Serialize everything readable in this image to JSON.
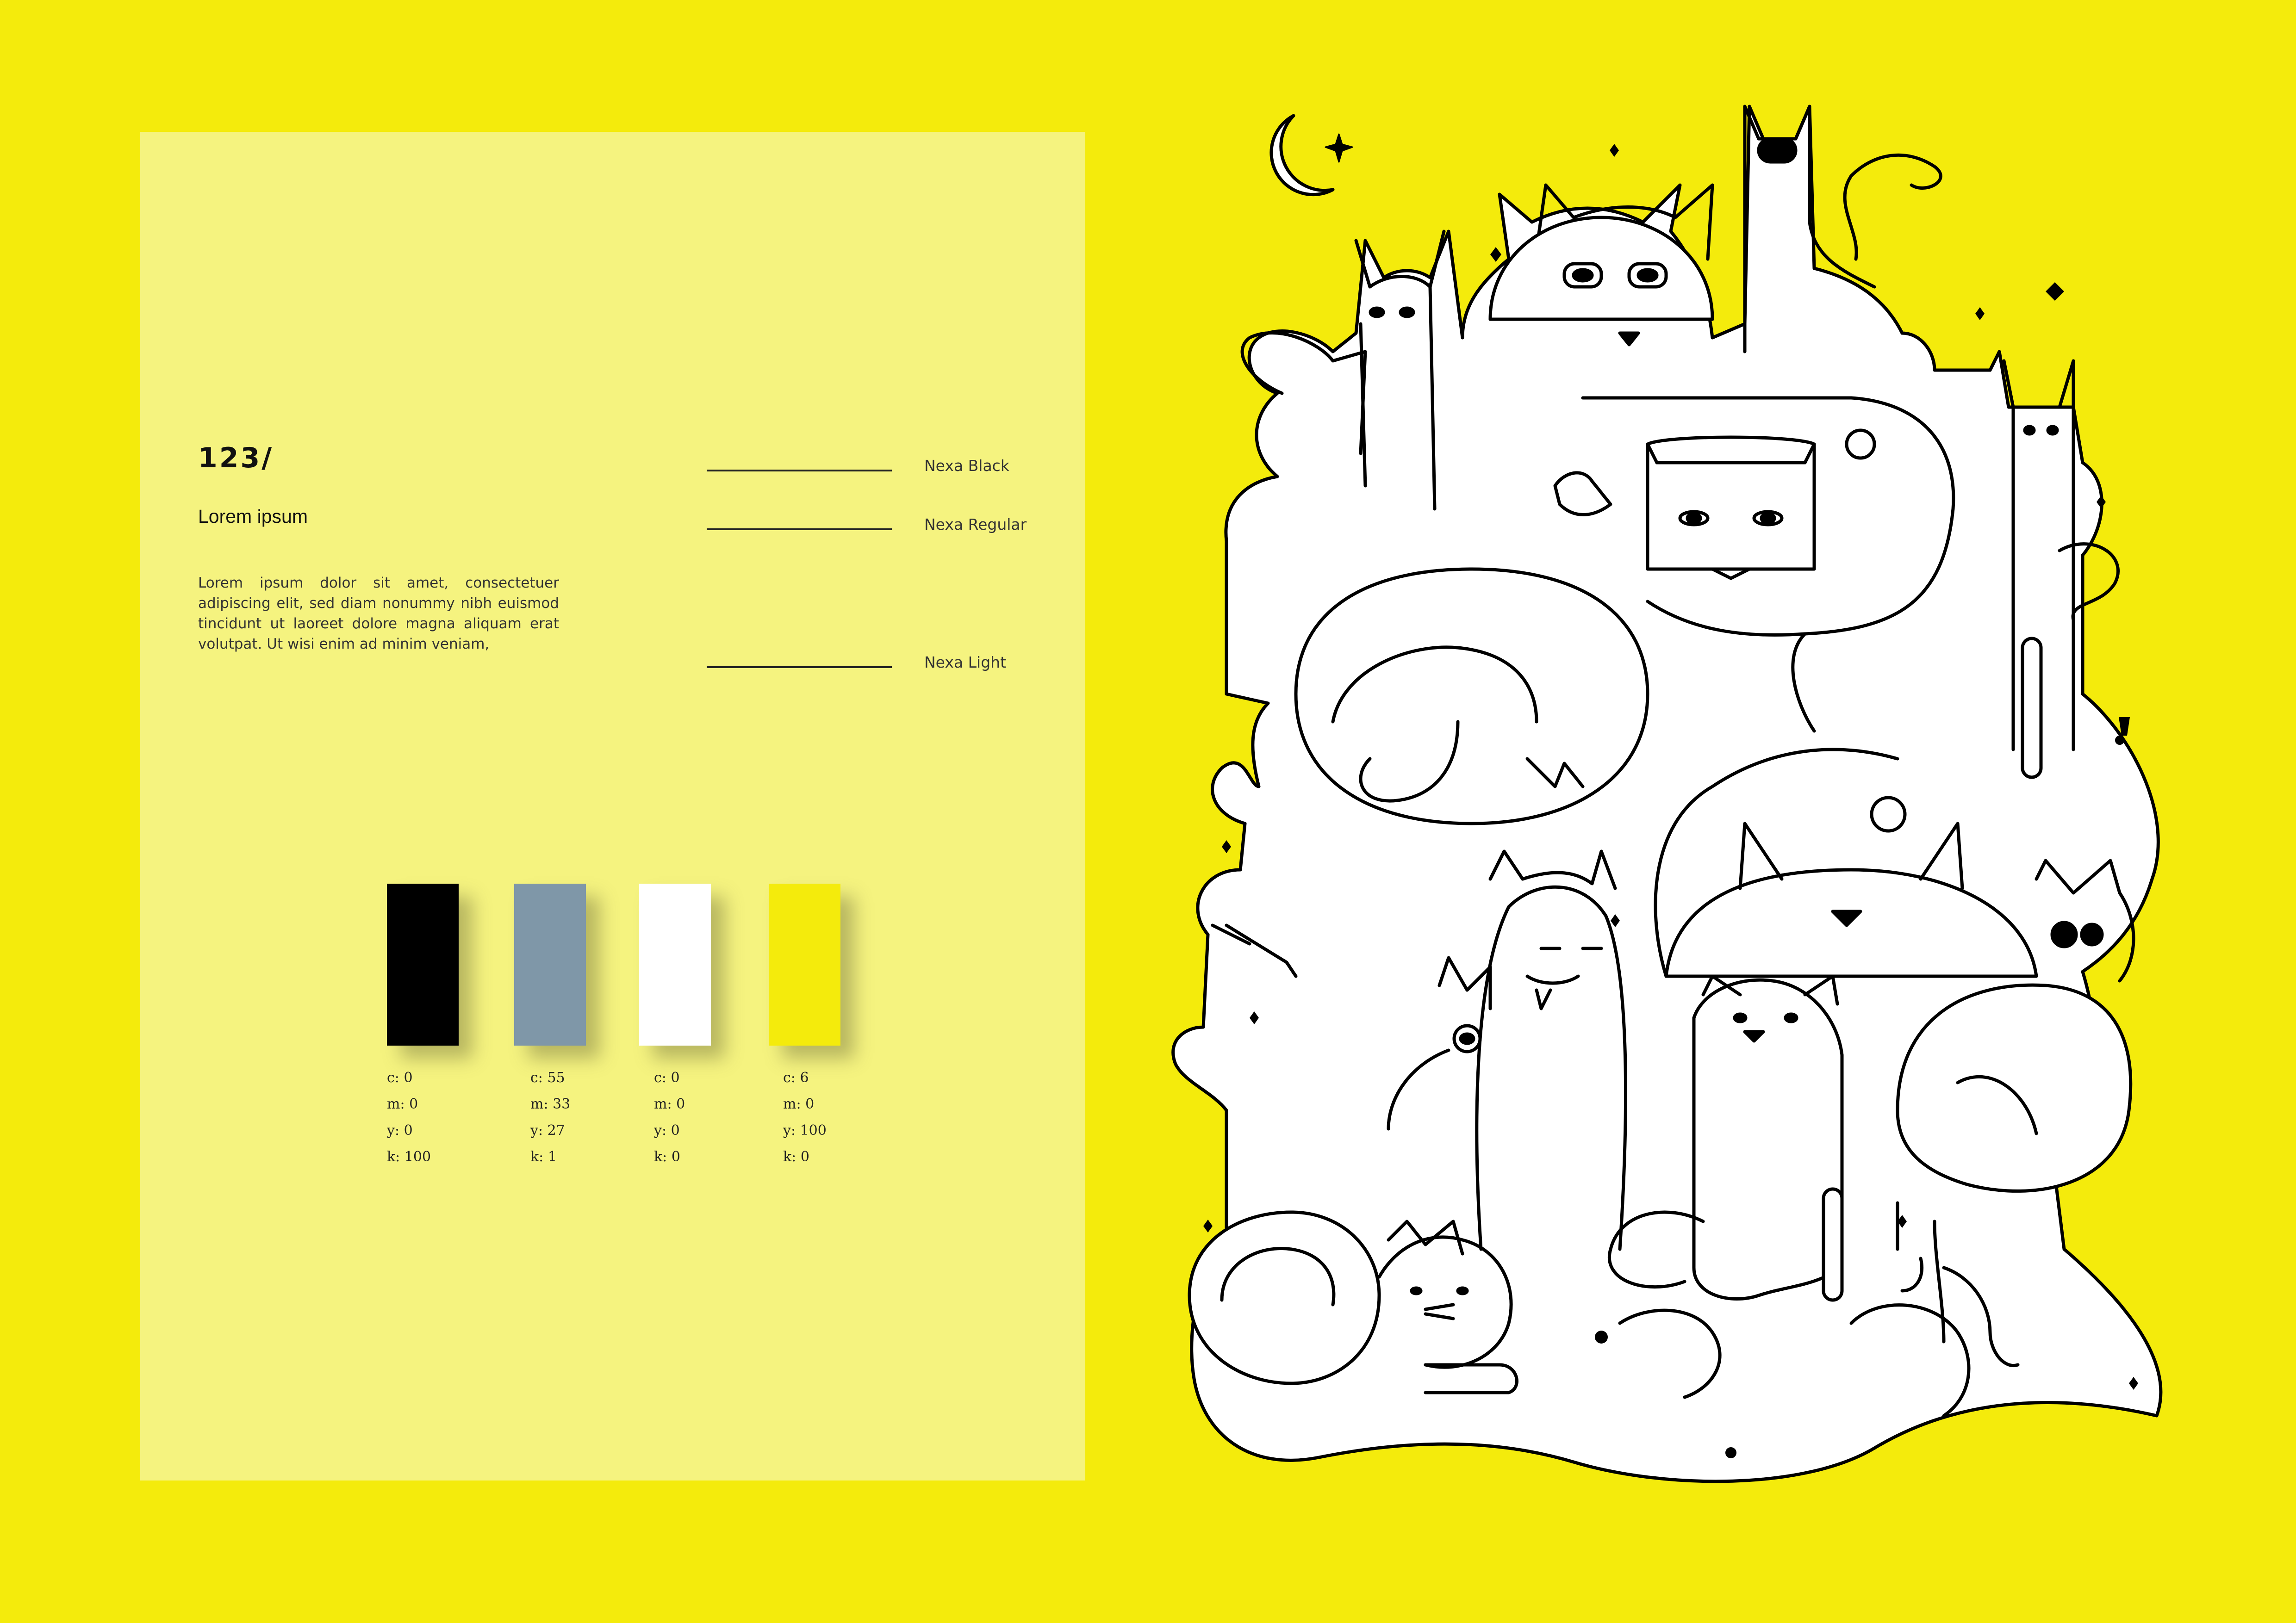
{
  "panel": {
    "number": "123/",
    "subtitle": "Lorem ipsum",
    "body": "Lorem ipsum dolor sit amet, consectetuer adipiscing elit, sed diam nonummy nibh euismod tincidunt ut laoreet dolore magna aliquam erat volutpat. Ut wisi enim ad minim veniam,"
  },
  "fonts": [
    {
      "label": "Nexa Black"
    },
    {
      "label": "Nexa Regular"
    },
    {
      "label": "Nexa Light"
    }
  ],
  "swatches": [
    {
      "color": "#000000",
      "c": "c: 0",
      "m": "m: 0",
      "y": "y: 0",
      "k": "k: 100"
    },
    {
      "color": "#7f97a8",
      "c": "c: 55",
      "m": "m: 33",
      "y": "y: 27",
      "k": "k: 1"
    },
    {
      "color": "#ffffff",
      "c": "c: 0",
      "m": "m: 0",
      "y": "y: 0",
      "k": "k: 0"
    },
    {
      "color": "#f4eb0c",
      "c": "c: 6",
      "m": "m: 0",
      "y": "y: 100",
      "k": "k: 0"
    }
  ],
  "colors": {
    "background": "#f4eb0c",
    "panel": "#f5f37f",
    "ink": "#000000"
  }
}
